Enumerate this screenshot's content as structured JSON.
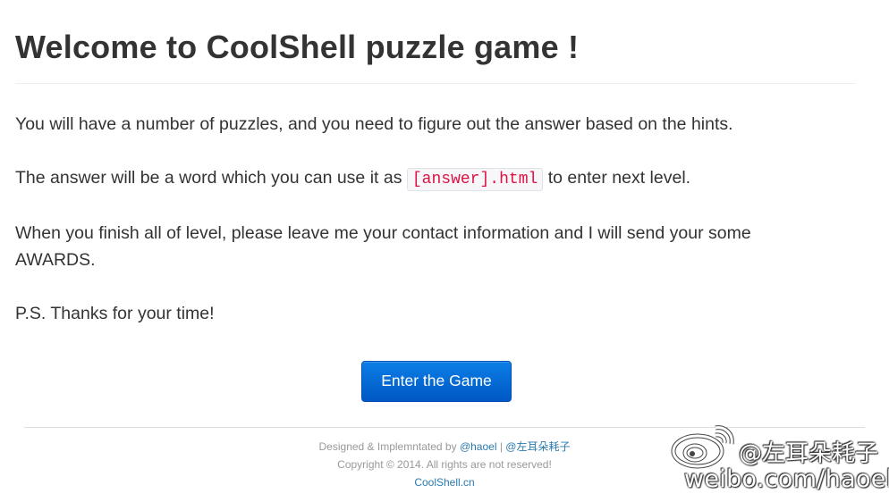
{
  "header": {
    "title": "Welcome to CoolShell puzzle game !"
  },
  "intro": {
    "paragraph1": "You will have a number of puzzles, and you need to figure out the answer based on the hints.",
    "paragraph2_before": "The answer will be a word which you can use it as ",
    "paragraph2_code": "[answer].html",
    "paragraph2_after": " to enter next level.",
    "paragraph3": "When you finish all of level, please leave me your contact information and I will send your some AWARDS.",
    "paragraph4": "P.S. Thanks for your time!"
  },
  "actions": {
    "enter_label": "Enter the Game"
  },
  "footer": {
    "designed_prefix": "Designed & Implemntated by ",
    "author_link": "@haoel",
    "separator": " | ",
    "weibo_link": "@左耳朵耗子",
    "copyright": "Copyright © 2014. All rights are not reserved!",
    "site_link": "CoolShell.cn"
  },
  "watermark": {
    "logo_icon": "weibo-logo-icon",
    "handle": "@左耳朵耗子",
    "url": "weibo.com/haoel"
  },
  "colors": {
    "button_top": "#0b7ee6",
    "button_bottom": "#0058c4",
    "code_text": "#dd1144",
    "link": "#2a7ab0"
  }
}
